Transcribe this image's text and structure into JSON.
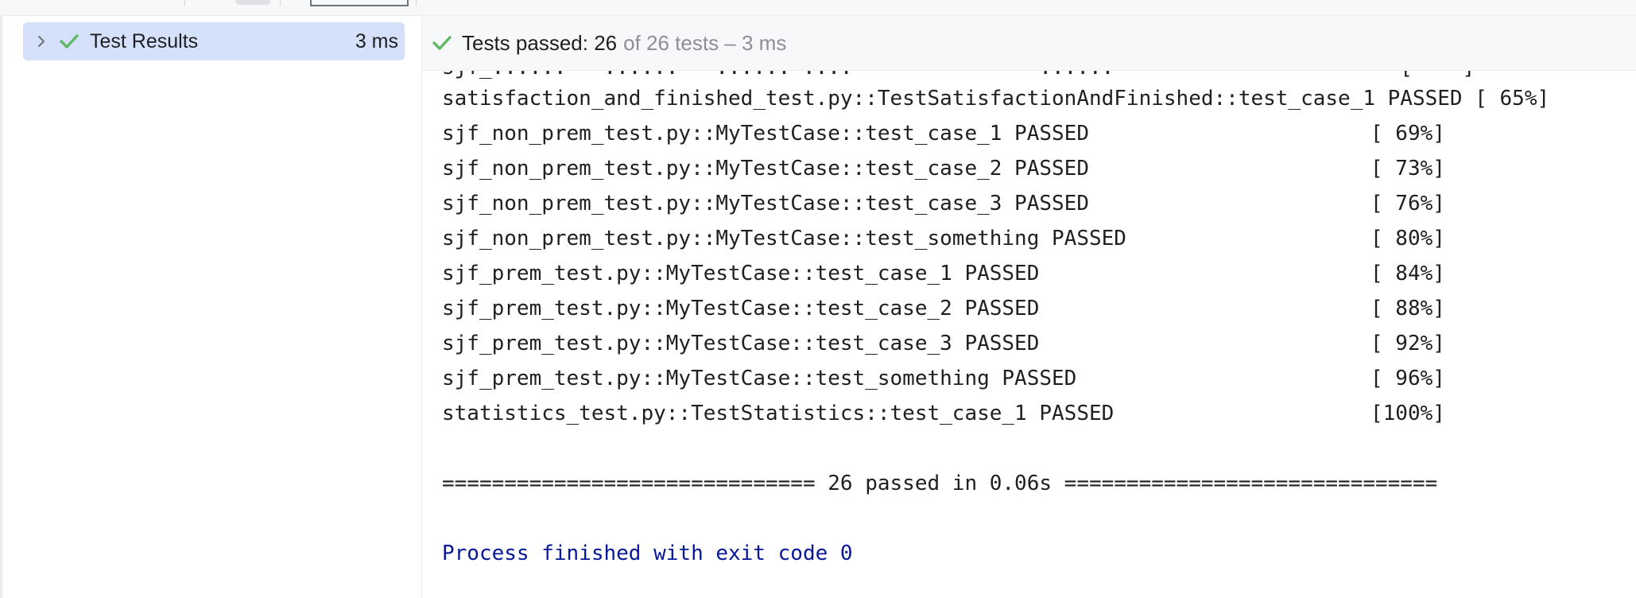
{
  "tree": {
    "root_label": "Test Results",
    "root_time": "3 ms",
    "icons": {
      "expand": "chevron-right-icon",
      "status": "check-icon"
    }
  },
  "status_bar": {
    "passed_text": "Tests passed: 26",
    "total_text": "of 26 tests – 3 ms",
    "icon": "check-icon"
  },
  "console": {
    "lines": [
      {
        "text": "satisfaction_and_finished_test.py::TestSatisfactionAndFinished::test_case_1 PASSED [ 65%]",
        "pct": ""
      },
      {
        "text": "sjf_non_prem_test.py::MyTestCase::test_case_1 PASSED",
        "pct": "[ 69%]"
      },
      {
        "text": "sjf_non_prem_test.py::MyTestCase::test_case_2 PASSED",
        "pct": "[ 73%]"
      },
      {
        "text": "sjf_non_prem_test.py::MyTestCase::test_case_3 PASSED",
        "pct": "[ 76%]"
      },
      {
        "text": "sjf_non_prem_test.py::MyTestCase::test_something PASSED",
        "pct": "[ 80%]"
      },
      {
        "text": "sjf_prem_test.py::MyTestCase::test_case_1 PASSED",
        "pct": "[ 84%]"
      },
      {
        "text": "sjf_prem_test.py::MyTestCase::test_case_2 PASSED",
        "pct": "[ 88%]"
      },
      {
        "text": "sjf_prem_test.py::MyTestCase::test_case_3 PASSED",
        "pct": "[ 92%]"
      },
      {
        "text": "sjf_prem_test.py::MyTestCase::test_something PASSED",
        "pct": "[ 96%]"
      },
      {
        "text": "statistics_test.py::TestStatistics::test_case_1 PASSED",
        "pct": "[100%]"
      }
    ],
    "summary": "============================== 26 passed in 0.06s ==============================",
    "finished": "Process finished with exit code 0"
  },
  "colors": {
    "success_green": "#5fb865",
    "selection_blue": "#d5e1fb",
    "exit_text_blue": "#071799",
    "muted_gray": "#8c8f96"
  }
}
